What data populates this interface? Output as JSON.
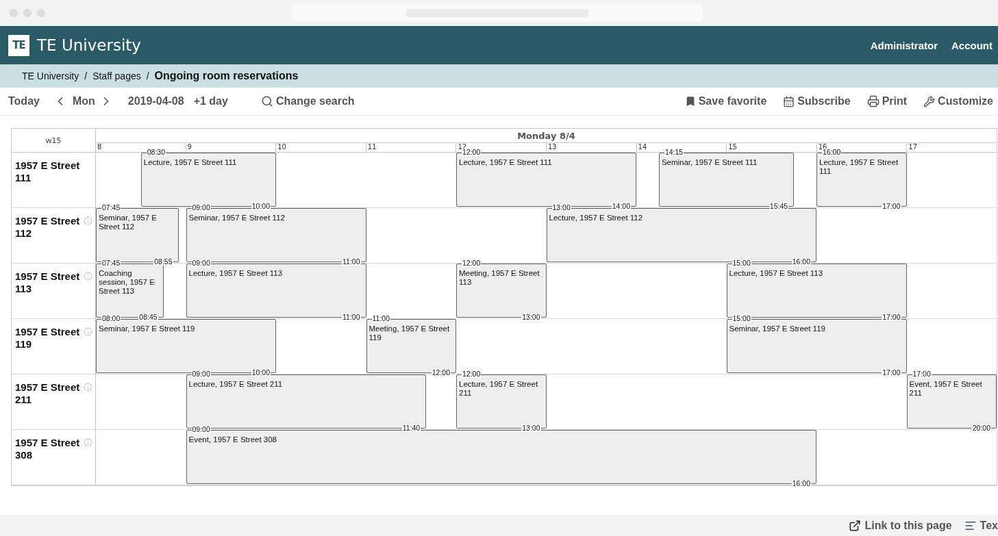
{
  "brand": {
    "logo": "TE",
    "title": "TE University"
  },
  "user_menu": [
    "Administrator",
    "Account"
  ],
  "breadcrumb": [
    {
      "label": "TE University",
      "current": false
    },
    {
      "label": "Staff pages",
      "current": false
    },
    {
      "label": "Ongoing room reservations",
      "current": true
    }
  ],
  "breadcrumb_separator": "/",
  "toolbar": {
    "today": "Today",
    "view": "Mon",
    "date": "2019-04-08",
    "step": "+1 day",
    "search": "Change search",
    "actions": [
      {
        "kind": "favorite",
        "label": "Save favorite"
      },
      {
        "kind": "subscribe",
        "label": "Subscribe"
      },
      {
        "kind": "print",
        "label": "Print"
      },
      {
        "kind": "customize",
        "label": "Customize"
      }
    ]
  },
  "schedule": {
    "week": "w15",
    "day": "Monday 8/4",
    "hours": [
      "8",
      "9",
      "10",
      "11",
      "12",
      "13",
      "14",
      "15",
      "16",
      "17"
    ],
    "rooms": [
      {
        "name": "1957 E Street 111",
        "info_icon": false,
        "events": [
          {
            "title": "Lecture, 1957 E Street 111",
            "start": "08:30",
            "end": "10:00"
          },
          {
            "title": "Lecture, 1957 E Street 111",
            "start": "12:00",
            "end": "14:00"
          },
          {
            "title": "Seminar, 1957 E Street 111",
            "start": "14:15",
            "end": "15:45"
          },
          {
            "title": "Lecture, 1957 E Street 111",
            "start": "16:00",
            "end": "17:00"
          }
        ]
      },
      {
        "name": "1957 E Street 112",
        "info_icon": true,
        "events": [
          {
            "title": "Seminar, 1957 E Street 112",
            "start": "07:45",
            "end": "08:55"
          },
          {
            "title": "Seminar, 1957 E Street 112",
            "start": "09:00",
            "end": "11:00"
          },
          {
            "title": "Lecture, 1957 E Street 112",
            "start": "13:00",
            "end": "16:00"
          }
        ]
      },
      {
        "name": "1957 E Street 113",
        "info_icon": true,
        "events": [
          {
            "title": "Coaching session, 1957 E Street 113",
            "start": "07:45",
            "end": "08:45"
          },
          {
            "title": "Lecture, 1957 E Street 113",
            "start": "09:00",
            "end": "11:00"
          },
          {
            "title": "Meeting, 1957 E Street 113",
            "start": "12:00",
            "end": "13:00"
          },
          {
            "title": "Lecture, 1957 E Street 113",
            "start": "15:00",
            "end": "17:00"
          }
        ]
      },
      {
        "name": "1957 E Street 119",
        "info_icon": true,
        "events": [
          {
            "title": "Seminar, 1957 E Street 119",
            "start": "08:00",
            "end": "10:00"
          },
          {
            "title": "Meeting, 1957 E Street 119",
            "start": "11:00",
            "end": "12:00"
          },
          {
            "title": "Seminar, 1957 E Street 119",
            "start": "15:00",
            "end": "17:00"
          }
        ]
      },
      {
        "name": "1957 E Street 211",
        "info_icon": true,
        "events": [
          {
            "title": "Lecture, 1957 E Street 211",
            "start": "09:00",
            "end": "11:40"
          },
          {
            "title": "Lecture, 1957 E Street 211",
            "start": "12:00",
            "end": "13:00"
          },
          {
            "title": "Event, 1957 E Street 211",
            "start": "17:00",
            "end": "20:00"
          }
        ]
      },
      {
        "name": "1957 E Street 308",
        "info_icon": true,
        "events": [
          {
            "title": "Event, 1957 E Street 308",
            "start": "09:00",
            "end": "16:00"
          }
        ]
      }
    ]
  },
  "footer": [
    {
      "kind": "link",
      "label": "Link to this page"
    },
    {
      "kind": "text",
      "label": "Tex"
    }
  ]
}
